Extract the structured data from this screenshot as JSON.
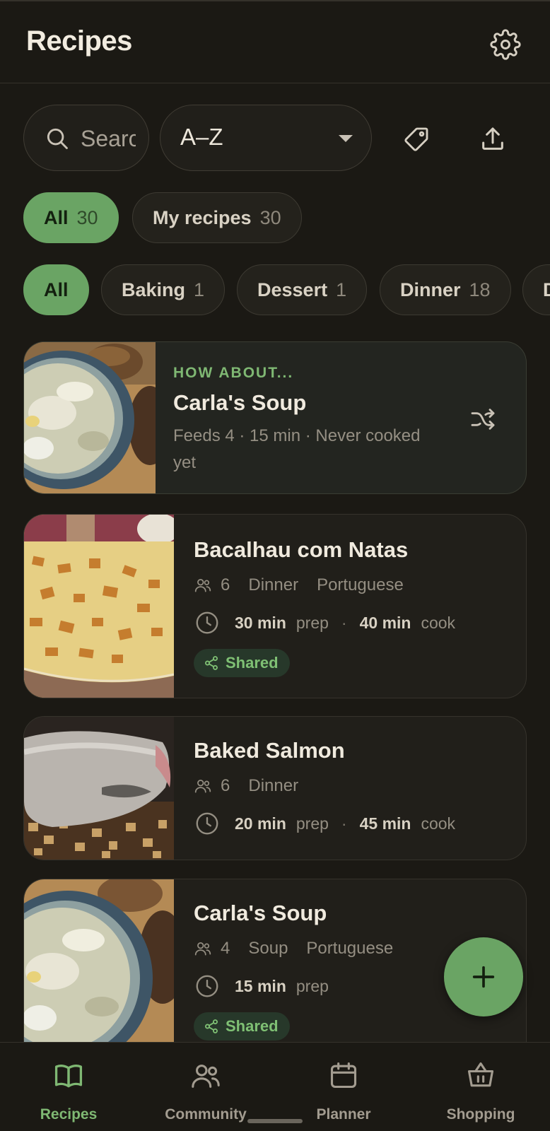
{
  "app": {
    "title": "Recipes"
  },
  "toolbar": {
    "search_placeholder": "Search",
    "sort_value": "A–Z"
  },
  "owner_filter": [
    {
      "label": "All",
      "count": "30",
      "active": true
    },
    {
      "label": "My recipes",
      "count": "30",
      "active": false
    }
  ],
  "category_filter": [
    {
      "label": "All",
      "count": "",
      "active": true
    },
    {
      "label": "Baking",
      "count": "1"
    },
    {
      "label": "Dessert",
      "count": "1"
    },
    {
      "label": "Dinner",
      "count": "18"
    },
    {
      "label": "D",
      "count": ""
    }
  ],
  "suggestion": {
    "eyebrow": "HOW ABOUT...",
    "title": "Carla's Soup",
    "meta": "Feeds 4 · 15 min · Never cooked yet"
  },
  "recipes": [
    {
      "title": "Bacalhau com Natas",
      "servings": "6",
      "tags": [
        "Dinner",
        "Portuguese"
      ],
      "prep": "30 min",
      "prep_label": "prep",
      "cook": "40 min",
      "cook_label": "cook",
      "shared": "Shared"
    },
    {
      "title": "Baked Salmon",
      "servings": "6",
      "tags": [
        "Dinner"
      ],
      "prep": "20 min",
      "prep_label": "prep",
      "cook": "45 min",
      "cook_label": "cook"
    },
    {
      "title": "Carla's Soup",
      "servings": "4",
      "tags": [
        "Soup",
        "Portuguese"
      ],
      "prep": "15 min",
      "prep_label": "prep",
      "shared": "Shared"
    }
  ],
  "nav": [
    {
      "label": "Recipes",
      "icon": "book-icon",
      "active": true
    },
    {
      "label": "Community",
      "icon": "people-icon"
    },
    {
      "label": "Planner",
      "icon": "calendar-icon"
    },
    {
      "label": "Shopping",
      "icon": "basket-icon"
    }
  ],
  "colors": {
    "accent": "#6aa464",
    "background": "#1b1914",
    "card": "#211f1a"
  }
}
